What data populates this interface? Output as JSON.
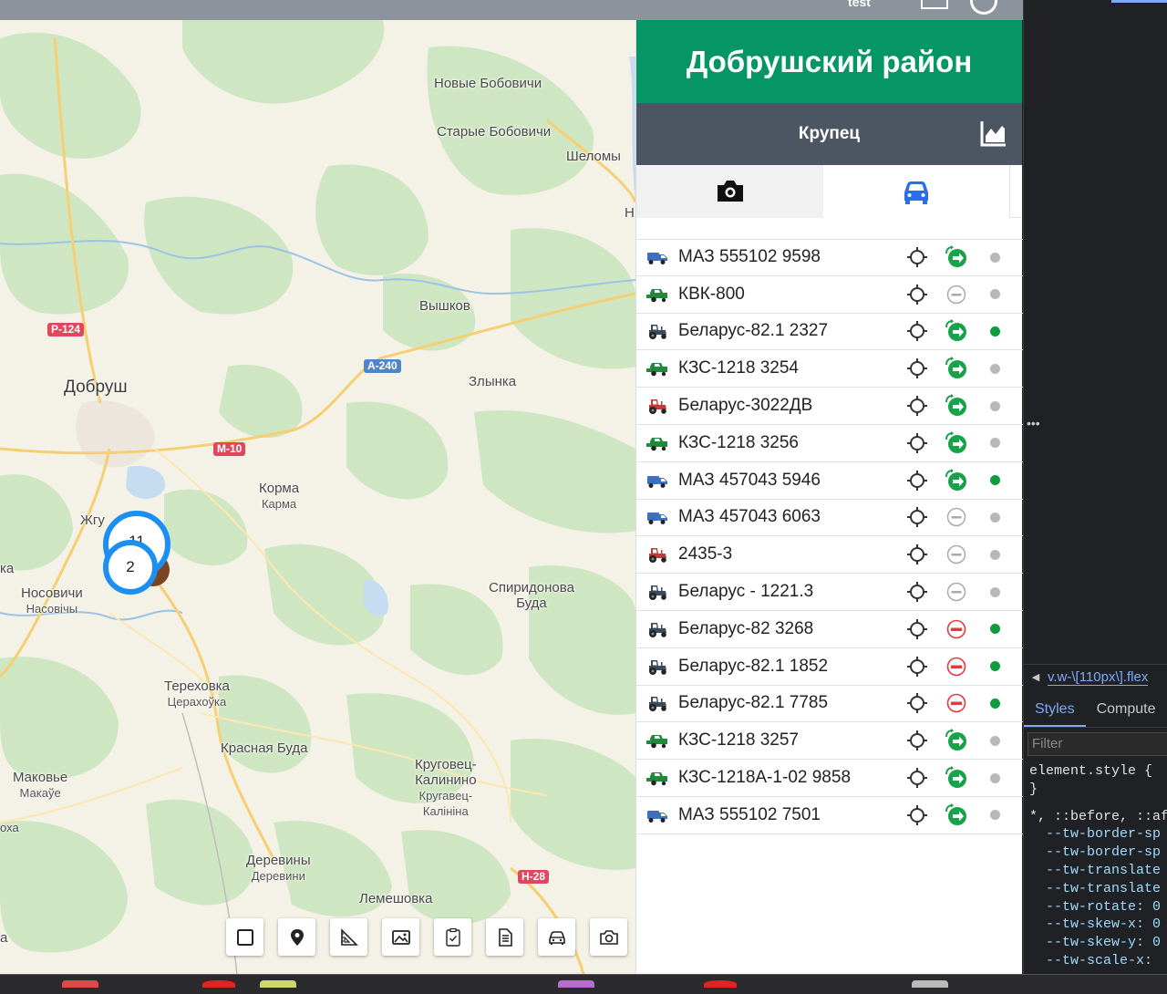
{
  "topbar": {
    "text": "test"
  },
  "map": {
    "labels": {
      "novye": "Новые Бобовичи",
      "starye": "Старые Бобовичи",
      "shelomy": "Шеломы",
      "vyshkov": "Вышков",
      "zlynka": "Злынка",
      "dobrush": "Добруш",
      "korma": "Корма",
      "korma_by": "Карма",
      "zhgu": "Жгу",
      "nosovichi": "Носовичи",
      "nosovichi_by": "Насовічы",
      "spiridonova": "Спиридонова",
      "buda": "Буда",
      "terehovka": "Тереховка",
      "terehovka_by": "Церахоўка",
      "krasnaya": "Красная Буда",
      "krugovets1": "Круговец-",
      "krugovets2": "Калинино",
      "krugovets3": "Кругавец-",
      "krugovets4": "Калініна",
      "makovye": "Маковье",
      "makovye_by": "Макаўе",
      "dereviny": "Деревины",
      "dereviny_by": "Дерeвини",
      "lemeshovka": "Лемешовка",
      "edge_ka": "ка",
      "edge_a": "а",
      "edge_oha": "оха",
      "edge_h": "Н"
    },
    "roads": {
      "r124": "Р-124",
      "a240": "А-240",
      "m10": "М-10",
      "h28": "Н-28"
    },
    "clusters": {
      "a": "11",
      "b": "2"
    }
  },
  "panel": {
    "district": "Добрушский район",
    "farm": "Крупец",
    "vehicles": [
      {
        "name": "МАЗ 555102 9598",
        "type": "truck",
        "color": "#3e6fbf",
        "state": "in",
        "online": false
      },
      {
        "name": "КВК-800",
        "type": "harvester",
        "color": "#1f8a3a",
        "state": "idle",
        "online": false
      },
      {
        "name": "Беларус-82.1 2327",
        "type": "tractor",
        "color": "#3c4a5e",
        "state": "in",
        "online": true
      },
      {
        "name": "КЗС-1218 3254",
        "type": "harvester",
        "color": "#1f8a3a",
        "state": "in",
        "online": false
      },
      {
        "name": "Беларус-3022ДВ",
        "type": "tractor",
        "color": "#c23b3b",
        "state": "in",
        "online": false
      },
      {
        "name": "КЗС-1218 3256",
        "type": "harvester",
        "color": "#1f8a3a",
        "state": "in",
        "online": false
      },
      {
        "name": "МАЗ 457043 5946",
        "type": "truck",
        "color": "#3e6fbf",
        "state": "in",
        "online": true
      },
      {
        "name": "МАЗ 457043 6063",
        "type": "truck",
        "color": "#3e6fbf",
        "state": "idle",
        "online": false
      },
      {
        "name": "2435-3",
        "type": "tractor",
        "color": "#c23b3b",
        "state": "idle",
        "online": false
      },
      {
        "name": "Беларус - 1221.3",
        "type": "tractor",
        "color": "#3c4a5e",
        "state": "idle",
        "online": false
      },
      {
        "name": "Беларус-82 3268",
        "type": "tractor",
        "color": "#3c4a5e",
        "state": "stop",
        "online": true
      },
      {
        "name": "Беларус-82.1 1852",
        "type": "tractor",
        "color": "#3c4a5e",
        "state": "stop",
        "online": true
      },
      {
        "name": "Беларус-82.1 7785",
        "type": "tractor",
        "color": "#3c4a5e",
        "state": "stop",
        "online": true
      },
      {
        "name": "КЗС-1218 3257",
        "type": "harvester",
        "color": "#1f8a3a",
        "state": "in",
        "online": false
      },
      {
        "name": "КЗС-1218А-1-02 9858",
        "type": "harvester",
        "color": "#1f8a3a",
        "state": "in",
        "online": false
      },
      {
        "name": "МАЗ 555102 7501",
        "type": "truck",
        "color": "#3e6fbf",
        "state": "in",
        "online": false
      }
    ]
  },
  "devtools": {
    "crumb": "v.w-\\[110px\\].flex",
    "tab_styles": "Styles",
    "tab_computed": "Compute",
    "filter_placeholder": "Filter",
    "code": [
      "element.style {",
      "}",
      "*, ::before, ::af",
      "  --tw-border-sp",
      "  --tw-border-sp",
      "  --tw-translate",
      "  --tw-translate",
      "  --tw-rotate: 0",
      "  --tw-skew-x: 0",
      "  --tw-skew-y: 0",
      "  --tw-scale-x: "
    ]
  },
  "colors": {
    "green_header": "#069665",
    "dark_header": "#4c5562",
    "cluster_blue": "#1d8ff3",
    "online_green": "#0f9d3d",
    "offline_grey": "#b8b8b8",
    "arrow_green": "#18a34a",
    "stop_red": "#e03a3a"
  }
}
